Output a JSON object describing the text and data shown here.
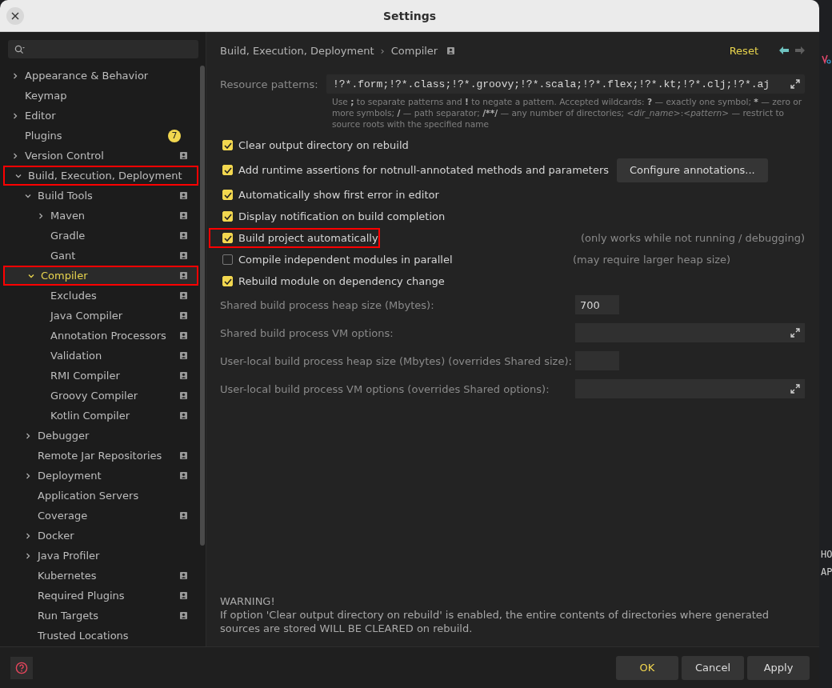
{
  "window": {
    "title": "Settings"
  },
  "sidebar": {
    "tree": [
      {
        "label": "Appearance & Behavior",
        "expanded": false,
        "selected": false,
        "highlighted": false,
        "project_scope": false
      },
      {
        "label": "Keymap",
        "selected": false,
        "highlighted": false,
        "project_scope": false
      },
      {
        "label": "Editor",
        "expanded": false,
        "selected": false,
        "highlighted": false,
        "project_scope": false
      },
      {
        "label": "Plugins",
        "badge": "7",
        "selected": false,
        "highlighted": false,
        "project_scope": false
      },
      {
        "label": "Version Control",
        "expanded": false,
        "selected": false,
        "highlighted": false,
        "project_scope": true
      },
      {
        "label": "Build, Execution, Deployment",
        "expanded": true,
        "selected": false,
        "highlighted": true,
        "project_scope": false,
        "children": [
          {
            "label": "Build Tools",
            "expanded": true,
            "selected": false,
            "highlighted": false,
            "project_scope": true,
            "children": [
              {
                "label": "Maven",
                "expanded": false,
                "selected": false,
                "highlighted": false,
                "project_scope": true
              },
              {
                "label": "Gradle",
                "selected": false,
                "highlighted": false,
                "project_scope": true
              },
              {
                "label": "Gant",
                "selected": false,
                "highlighted": false,
                "project_scope": true
              }
            ]
          },
          {
            "label": "Compiler",
            "expanded": true,
            "selected": true,
            "highlighted": true,
            "project_scope": true,
            "children": [
              {
                "label": "Excludes",
                "selected": false,
                "highlighted": false,
                "project_scope": true
              },
              {
                "label": "Java Compiler",
                "selected": false,
                "highlighted": false,
                "project_scope": true
              },
              {
                "label": "Annotation Processors",
                "selected": false,
                "highlighted": false,
                "project_scope": true
              },
              {
                "label": "Validation",
                "selected": false,
                "highlighted": false,
                "project_scope": true
              },
              {
                "label": "RMI Compiler",
                "selected": false,
                "highlighted": false,
                "project_scope": true
              },
              {
                "label": "Groovy Compiler",
                "selected": false,
                "highlighted": false,
                "project_scope": true
              },
              {
                "label": "Kotlin Compiler",
                "selected": false,
                "highlighted": false,
                "project_scope": true
              }
            ]
          },
          {
            "label": "Debugger",
            "expanded": false,
            "selected": false,
            "highlighted": false,
            "project_scope": false
          },
          {
            "label": "Remote Jar Repositories",
            "selected": false,
            "highlighted": false,
            "project_scope": true
          },
          {
            "label": "Deployment",
            "expanded": false,
            "selected": false,
            "highlighted": false,
            "project_scope": true
          },
          {
            "label": "Application Servers",
            "selected": false,
            "highlighted": false,
            "project_scope": false
          },
          {
            "label": "Coverage",
            "selected": false,
            "highlighted": false,
            "project_scope": true
          },
          {
            "label": "Docker",
            "expanded": false,
            "selected": false,
            "highlighted": false,
            "project_scope": false
          },
          {
            "label": "Java Profiler",
            "expanded": false,
            "selected": false,
            "highlighted": false,
            "project_scope": false
          },
          {
            "label": "Kubernetes",
            "selected": false,
            "highlighted": false,
            "project_scope": true
          },
          {
            "label": "Required Plugins",
            "selected": false,
            "highlighted": false,
            "project_scope": true
          },
          {
            "label": "Run Targets",
            "selected": false,
            "highlighted": false,
            "project_scope": true
          },
          {
            "label": "Trusted Locations",
            "selected": false,
            "highlighted": false,
            "project_scope": false
          }
        ]
      }
    ]
  },
  "header": {
    "breadcrumb": [
      "Build, Execution, Deployment",
      "Compiler"
    ],
    "separator": "›",
    "project_scope": true,
    "reset": "Reset"
  },
  "resource_patterns": {
    "label": "Resource patterns:",
    "value": "!?*.form;!?*.class;!?*.groovy;!?*.scala;!?*.flex;!?*.kt;!?*.clj;!?*.aj",
    "hint": [
      {
        "text": "Use ",
        "kind": "prose"
      },
      {
        "text": ";",
        "kind": "symbol"
      },
      {
        "text": " to separate patterns and ",
        "kind": "prose"
      },
      {
        "text": "!",
        "kind": "symbol"
      },
      {
        "text": " to negate a pattern. Accepted wildcards: ",
        "kind": "prose"
      },
      {
        "text": "?",
        "kind": "symbol"
      },
      {
        "text": " — exactly one symbol; ",
        "kind": "prose"
      },
      {
        "text": "*",
        "kind": "symbol"
      },
      {
        "text": " — zero or more symbols; ",
        "kind": "prose"
      },
      {
        "text": "/",
        "kind": "symbol"
      },
      {
        "text": " — path separator; ",
        "kind": "prose"
      },
      {
        "text": "/**/",
        "kind": "symbol"
      },
      {
        "text": " — any number of directories; ",
        "kind": "prose"
      },
      {
        "text": "<dir_name>",
        "kind": "variable"
      },
      {
        "text": ":",
        "kind": "prose"
      },
      {
        "text": "<pattern>",
        "kind": "variable"
      },
      {
        "text": " — restrict to source roots with the specified name",
        "kind": "prose"
      }
    ]
  },
  "options": [
    {
      "label": "Clear output directory on rebuild",
      "checked": true,
      "highlighted": false
    },
    {
      "label": "Add runtime assertions for notnull-annotated methods and parameters",
      "checked": true,
      "highlighted": false,
      "button": "Configure annotations..."
    },
    {
      "label": "Automatically show first error in editor",
      "checked": true,
      "highlighted": false
    },
    {
      "label": "Display notification on build completion",
      "checked": true,
      "highlighted": false
    },
    {
      "label": "Build project automatically",
      "checked": true,
      "highlighted": true,
      "note": "(only works while not running / debugging)"
    },
    {
      "label": "Compile independent modules in parallel",
      "checked": false,
      "highlighted": false,
      "note": "(may require larger heap size)"
    },
    {
      "label": "Rebuild module on dependency change",
      "checked": true,
      "highlighted": false
    }
  ],
  "fields": [
    {
      "kind": "short",
      "label": "Shared build process heap size (Mbytes):",
      "value": "700"
    },
    {
      "kind": "expandable",
      "label": "Shared build process VM options:"
    },
    {
      "kind": "short",
      "label": "User-local build process heap size (Mbytes) (overrides Shared size):"
    },
    {
      "kind": "expandable",
      "label": "User-local build process VM options (overrides Shared options):"
    }
  ],
  "warning": {
    "title": "WARNING!",
    "text": "If option 'Clear output directory on rebuild' is enabled, the entire contents of directories where generated sources are stored WILL BE CLEARED on rebuild."
  },
  "buttons": [
    {
      "label": "OK",
      "default": true
    },
    {
      "label": "Cancel",
      "default": false
    },
    {
      "label": "Apply",
      "default": false
    }
  ],
  "background_window": {
    "texts": [
      "HO",
      "AP"
    ]
  }
}
